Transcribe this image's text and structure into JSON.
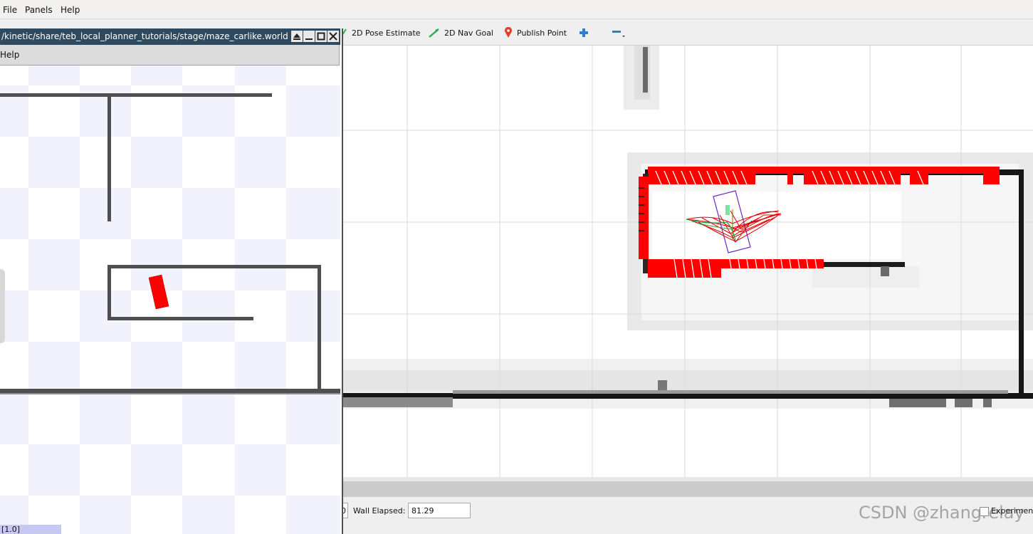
{
  "rviz": {
    "menu": {
      "file": "File",
      "panels": "Panels",
      "help": "Help"
    },
    "tools": [
      {
        "name": "2d-pose-estimate",
        "label": "2D Pose Estimate",
        "icon": "green-arrow-icon"
      },
      {
        "name": "2d-nav-goal",
        "label": "2D Nav Goal",
        "icon": "green-arrow-icon"
      },
      {
        "name": "publish-point",
        "label": "Publish Point",
        "icon": "map-pin-icon"
      }
    ],
    "view_controls": {
      "add_icon": "plus-icon",
      "remove_icon": "minus-icon"
    },
    "time": {
      "stub_value": "0",
      "wall_elapsed_label": "Wall Elapsed:",
      "wall_elapsed_value": "81.29",
      "experimental_label": "Experiment"
    },
    "watermark": "CSDN @zhangrelay"
  },
  "stage": {
    "title": "/kinetic/share/teb_local_planner_tutorials/stage/maze_carlike.world",
    "menu_text": "Help",
    "status_text": "[1.0]",
    "window_buttons": {
      "eject": "eject-icon",
      "minimize": "minimize-icon",
      "maximize": "maximize-icon",
      "close": "close-icon"
    }
  },
  "colors": {
    "obstacle_red": "#ff0000",
    "wall_dark": "#4f4f4f",
    "checker": "#f2f2fc",
    "titlebar": "#2f4a5e",
    "footprint": "#6a2ac8"
  }
}
